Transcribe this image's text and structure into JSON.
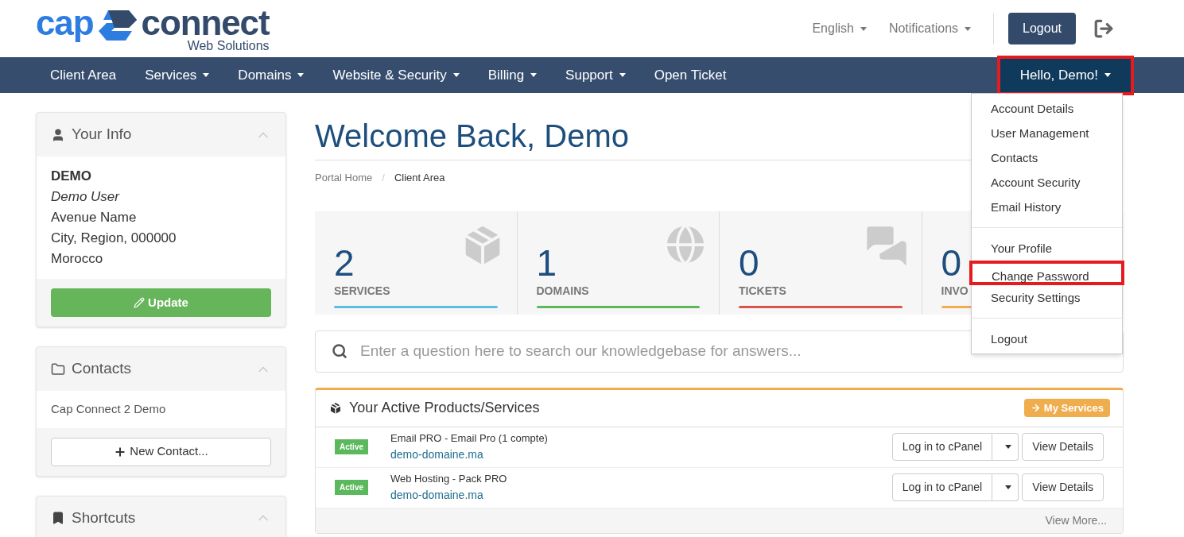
{
  "logo": {
    "part_1": "cap",
    "part_2": "connect",
    "tagline": "Web Solutions"
  },
  "top_links": [
    {
      "label": "English",
      "caret": true
    },
    {
      "label": "Notifications",
      "caret": true
    }
  ],
  "logout_button": "Logout",
  "nav": {
    "items": [
      {
        "label": "Client Area",
        "caret": false
      },
      {
        "label": "Services",
        "caret": true
      },
      {
        "label": "Domains",
        "caret": true
      },
      {
        "label": "Website & Security",
        "caret": true
      },
      {
        "label": "Billing",
        "caret": true
      },
      {
        "label": "Support",
        "caret": true
      },
      {
        "label": "Open Ticket",
        "caret": false
      }
    ],
    "account": {
      "label": "Hello, Demo!",
      "highlighted": true,
      "expanded": true
    }
  },
  "account_menu": [
    {
      "items": [
        {
          "label": "Account Details",
          "highlighted": false
        },
        {
          "label": "User Management",
          "highlighted": false
        },
        {
          "label": "Contacts",
          "highlighted": false
        },
        {
          "label": "Account Security",
          "highlighted": false
        },
        {
          "label": "Email History",
          "highlighted": false
        }
      ]
    },
    {
      "items": [
        {
          "label": "Your Profile",
          "highlighted": false
        },
        {
          "label": "Change Password",
          "highlighted": true
        },
        {
          "label": "Security Settings",
          "highlighted": false
        }
      ]
    },
    {
      "items": [
        {
          "label": "Logout",
          "highlighted": false
        }
      ]
    }
  ],
  "sidebar": {
    "your_info": {
      "title": "Your Info",
      "name": "DEMO",
      "role": "Demo User",
      "lines": [
        "Avenue Name",
        "City, Region, 000000",
        "Morocco"
      ],
      "button": "Update"
    },
    "contacts": {
      "title": "Contacts",
      "items": [
        "Cap Connect 2 Demo"
      ],
      "button": "New Contact..."
    },
    "shortcuts": {
      "title": "Shortcuts"
    }
  },
  "page_title": "Welcome Back, Demo",
  "breadcrumb": {
    "separator": "/",
    "items": [
      {
        "label": "Portal Home",
        "selected": false
      },
      {
        "label": "Client Area",
        "selected": true
      }
    ]
  },
  "stats": [
    {
      "kind": "services",
      "count": "2",
      "label": "SERVICES",
      "color": "#5bc0de"
    },
    {
      "kind": "domains",
      "count": "1",
      "label": "DOMAINS",
      "color": "#5cb85c"
    },
    {
      "kind": "tickets",
      "count": "0",
      "label": "TICKETS",
      "color": "#d9534f"
    },
    {
      "kind": "invoices",
      "count": "0",
      "label": "INVO",
      "color": "#f0ad4e"
    }
  ],
  "search": {
    "placeholder": "Enter a question here to search our knowledgebase for answers..."
  },
  "products_panel": {
    "title": "Your Active Products/Services",
    "header_button": "My Services",
    "rows": [
      {
        "status": "Active",
        "product": "Email PRO - Email Pro (1 compte)",
        "domain": "demo-domaine.ma",
        "login_button": "Log in to cPanel",
        "details_button": "View Details"
      },
      {
        "status": "Active",
        "product": "Web Hosting - Pack PRO",
        "domain": "demo-domaine.ma",
        "login_button": "Log in to cPanel",
        "details_button": "View Details"
      }
    ],
    "footer_link": "View More..."
  }
}
